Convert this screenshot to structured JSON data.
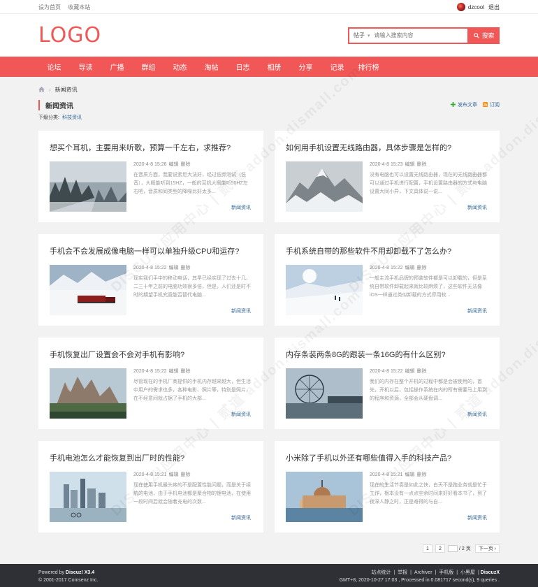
{
  "topbar": {
    "set_home": "设为首页",
    "bookmark": "收藏本站",
    "username": "dzcool",
    "logout": "退出"
  },
  "header": {
    "logo": "LOGO",
    "search_type": "帖子",
    "search_placeholder": "请输入搜索内容",
    "search_button": "搜索"
  },
  "nav": [
    "论坛",
    "导读",
    "广播",
    "群组",
    "动态",
    "淘帖",
    "日志",
    "相册",
    "分享",
    "记录",
    "排行榜"
  ],
  "breadcrumb": {
    "current": "新闻资讯"
  },
  "page": {
    "title": "新闻资讯",
    "post_article": "发布文章",
    "subscribe": "订阅",
    "subcat_label": "下级分类:",
    "subcat_link": "科技资讯"
  },
  "articles": [
    {
      "title": "想买个耳机，主要用来听歌，预算一千左右，求推荐?",
      "date": "2020-4-8 15:26",
      "edit": "编辑",
      "delete": "删除",
      "excerpt": "在音质方面，我要说索尼大法好，经过低频测试（低音），大概能听到15HZ，一般的耳机大概能听50HZ左右吧，音质和同类型的降噪比好太多...",
      "category": "新闻资讯",
      "image": "misty-forest"
    },
    {
      "title": "如何用手机设置无线路由器，具体步骤是怎样的?",
      "date": "2020-4-8 15:23",
      "edit": "编辑",
      "delete": "删除",
      "excerpt": "没有电脑也可以设置无线路由器，现在的无线路由器都可以通过手机进行配置，手机设置路由器的方式与电脑设置大同小异，下文具体说一说...",
      "category": "新闻资讯",
      "image": "snowy-mountains"
    },
    {
      "title": "手机会不会发展成像电脑一样可以单独升级CPU和运存?",
      "date": "2020-4-8 15:22",
      "edit": "编辑",
      "delete": "删除",
      "excerpt": "现实我们手中的移动电话，其早已经实现了过去十几、二三十年之前的电脑功效很多倍，但是，人们还是时不时的期望手机究竟能否替代电脑...",
      "category": "新闻资讯",
      "image": "snow-train"
    },
    {
      "title": "手机系统自带的那些软件不用却卸载不了怎么办?",
      "date": "2020-4-8 15:22",
      "edit": "编辑",
      "delete": "删除",
      "excerpt": "一般主流手机品牌的预装软件都是可以卸载的，但是系统自带软件卸载起来就比较麻烦了，这些软件无法像iOS一样通过类似卸载的方式停用软...",
      "category": "新闻资讯",
      "image": "ski-slope"
    },
    {
      "title": "手机恢复出厂设置会不会对手机有影响?",
      "date": "2020-4-8 15:22",
      "edit": "编辑",
      "delete": "删除",
      "excerpt": "尽管现在的手机厂商提供的手机内存越来越大，但生活中用户的需求也多，各种电影、照片等，特别是照片，在不经意间就占据了手机的大部...",
      "category": "新闻资讯",
      "image": "dolomites"
    },
    {
      "title": "内存条装两条8G的跟装一条16G的有什么区别?",
      "date": "2020-4-8 15:22",
      "edit": "编辑",
      "delete": "删除",
      "excerpt": "我们的内存在整个开机的过程中都是会被使用的，首先，开机以后，包括操作系统在内的所有需要马上用到的程序和资源，全部会从硬盘调...",
      "category": "新闻资讯",
      "image": "ferris-wheel"
    },
    {
      "title": "手机电池怎么才能恢复到出厂时的性能?",
      "date": "2020-4-8 15:21",
      "edit": "编辑",
      "delete": "删除",
      "excerpt": "现在使用手机最头疼的不是配置性能问题，而是关于续航的电池，由于手机电池都是聚合物的锂电池，在使用一段时间后就会随着充电的次数...",
      "category": "新闻资讯",
      "image": "city-skyline"
    },
    {
      "title": "小米除了手机以外还有哪些值得入手的科技产品?",
      "date": "2020-4-8 15:21",
      "edit": "编辑",
      "delete": "删除",
      "excerpt": "现在的生活节奏是如此之快，白天不是跑业务就是忙于工作，根本没有一点点空余时间来好好看本书了，到了夜深人静之时，正是难得的与自...",
      "category": "新闻资讯",
      "image": "venice"
    }
  ],
  "pagination": {
    "page1": "1",
    "page2": "2",
    "total": "/ 2 页",
    "next": "下一页 ›"
  },
  "footer": {
    "powered": "Powered by",
    "product": "Discuz! X3.4",
    "copyright": "© 2001-2017 Comsenz Inc.",
    "links": [
      "站点统计",
      "|",
      "举报",
      "|",
      "Archiver",
      "|",
      "手机版",
      "|",
      "小黑屋",
      "|"
    ],
    "brand": "DiscuzX",
    "stats": "GMT+8, 2020-10-27 17:03 , Processed in 0.081717 second(s), 9 queries ."
  },
  "watermark": "DISCUZ!应用中心 | 贰道 addon.dismall.com",
  "colors": {
    "accent": "#f25757",
    "link": "#336699",
    "footer": "#2e3036"
  }
}
